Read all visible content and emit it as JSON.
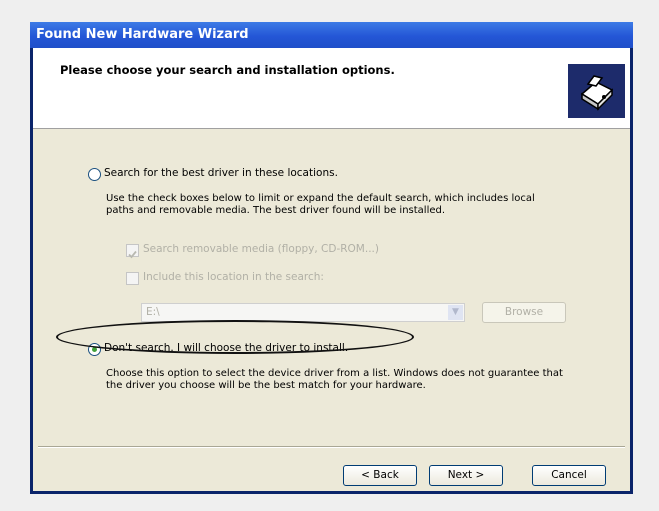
{
  "window": {
    "title": "Found New Hardware Wizard"
  },
  "header": {
    "title": "Please choose your search and installation options."
  },
  "option_search": {
    "label": "Search for the best driver in these locations.",
    "selected": false,
    "description_line1": "Use the check boxes below to limit or expand the default search, which includes local",
    "description_line2": "paths and removable media. The best driver found will be installed.",
    "search_removable": {
      "label": "Search removable media (floppy, CD-ROM...)",
      "checked": true,
      "enabled": false
    },
    "include_location": {
      "label": "Include this location in the search:",
      "checked": false,
      "enabled": false
    },
    "location_value": "E:\\",
    "browse_label": "Browse"
  },
  "option_dont_search": {
    "label": "Don't search. I will choose the driver to install.",
    "selected": true,
    "description_line1": "Choose this option to select the device driver from a list. Windows does not guarantee that",
    "description_line2": "the driver you choose will be the best match for your hardware."
  },
  "buttons": {
    "back": "< Back",
    "next": "Next >",
    "cancel": "Cancel"
  }
}
